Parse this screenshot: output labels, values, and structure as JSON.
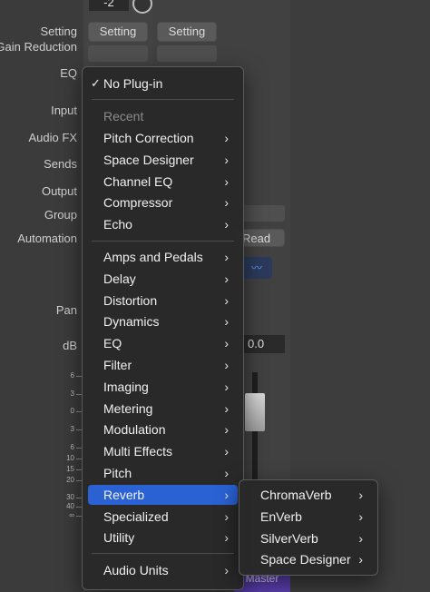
{
  "labels": {
    "setting": "Setting",
    "gain_reduction": "Gain Reduction",
    "eq": "EQ",
    "input": "Input",
    "audio_fx": "Audio FX",
    "sends": "Sends",
    "output": "Output",
    "group": "Group",
    "automation": "Automation",
    "pan": "Pan",
    "db": "dB"
  },
  "strip": {
    "top_value": "-2",
    "setting_button_a": "Setting",
    "setting_button_b": "Setting",
    "automation_mode": "Read",
    "db_value": "0.0",
    "master_label": "Master"
  },
  "scale": [
    "6",
    "3",
    "0",
    "3",
    "6",
    "10",
    "15",
    "20",
    "30",
    "40",
    "∞"
  ],
  "menu": {
    "no_plugin": "No Plug-in",
    "recent_header": "Recent",
    "recent": [
      "Pitch Correction",
      "Space Designer",
      "Channel EQ",
      "Compressor",
      "Echo"
    ],
    "categories": [
      "Amps and Pedals",
      "Delay",
      "Distortion",
      "Dynamics",
      "EQ",
      "Filter",
      "Imaging",
      "Metering",
      "Modulation",
      "Multi Effects",
      "Pitch",
      "Reverb",
      "Specialized",
      "Utility"
    ],
    "selected_category": "Reverb",
    "audio_units": "Audio Units"
  },
  "submenu": {
    "items": [
      "ChromaVerb",
      "EnVerb",
      "SilverVerb",
      "Space Designer"
    ]
  },
  "colors": {
    "selection": "#2a62d4",
    "master": "#5b3fb0"
  }
}
